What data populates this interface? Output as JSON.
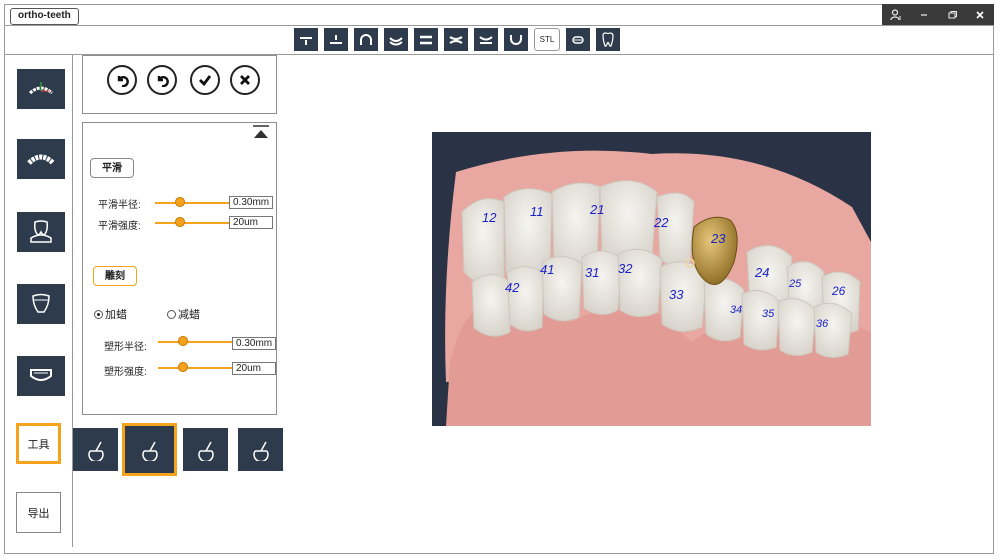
{
  "app": {
    "title": "ortho-teeth"
  },
  "window_controls": [
    "user-icon",
    "minimize-icon",
    "restore-icon",
    "close-icon"
  ],
  "top_toolbar": [
    {
      "icon": "align-top-icon"
    },
    {
      "icon": "align-center-icon"
    },
    {
      "icon": "arch-icon"
    },
    {
      "icon": "lower-curve-icon"
    },
    {
      "icon": "equal-icon"
    },
    {
      "icon": "crossed-lines-icon"
    },
    {
      "icon": "upper-curve-icon"
    },
    {
      "icon": "cup-icon"
    },
    {
      "label": "STL"
    },
    {
      "icon": "retainer-icon"
    },
    {
      "icon": "tooth-outline-icon"
    }
  ],
  "sidebar": {
    "tool_label": "工具",
    "export_label": "导出"
  },
  "panel": {
    "smooth_label": "平滑",
    "smooth_radius_label": "平滑半径:",
    "smooth_radius_value": "0.30mm",
    "smooth_strength_label": "平滑强度:",
    "smooth_strength_value": "20um",
    "sculpt_label": "雕刻",
    "add_wax_label": "加蜡",
    "remove_wax_label": "减蜡",
    "shape_radius_label": "塑形半径:",
    "shape_radius_value": "0.30mm",
    "shape_strength_label": "塑形强度:",
    "shape_strength_value": "20um"
  },
  "tooth_numbers": [
    "12",
    "11",
    "21",
    "22",
    "23",
    "42",
    "41",
    "31",
    "32",
    "33",
    "24",
    "25",
    "26",
    "34",
    "35",
    "36"
  ],
  "colors": {
    "accent": "#f5a21d",
    "toolbar_bg": "#2e3b4d",
    "tooth_label": "#1a22c8"
  }
}
